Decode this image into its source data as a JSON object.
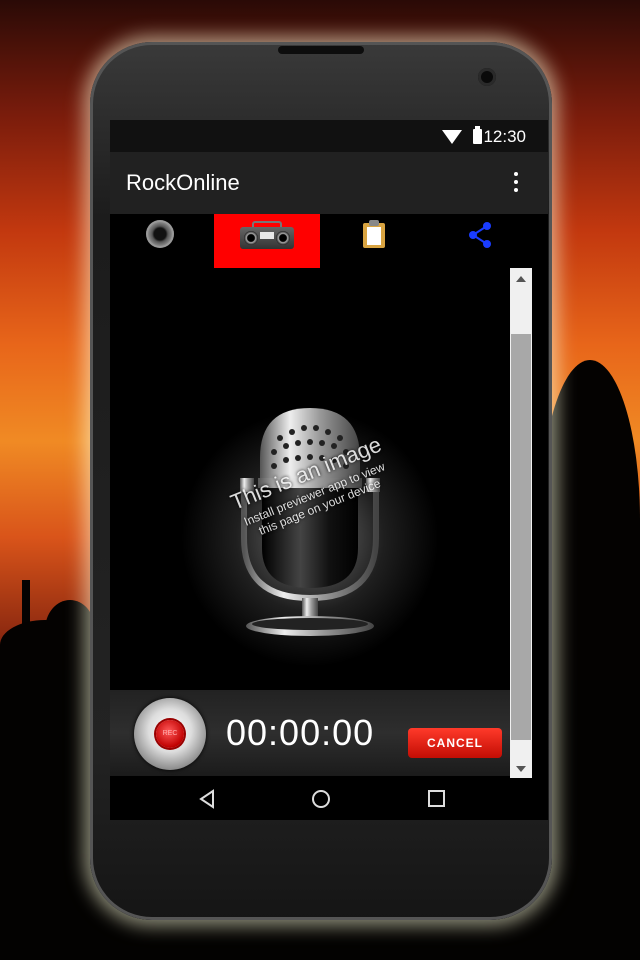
{
  "status_bar": {
    "time": "12:30"
  },
  "app_bar": {
    "title": "RockOnline"
  },
  "tabs": [
    {
      "icon": "speaker-icon",
      "active": false
    },
    {
      "icon": "radio-icon",
      "active": true
    },
    {
      "icon": "clipboard-icon",
      "active": false
    },
    {
      "icon": "share-icon",
      "active": false
    }
  ],
  "watermark": {
    "line1": "This is an image",
    "line2": "Install previewer app to view",
    "line3": "this page on your device"
  },
  "recorder": {
    "rec_label": "REC",
    "timer": "00:00:00",
    "cancel_label": "CANCEL"
  },
  "colors": {
    "active_tab": "#ff0000",
    "share_icon": "#1a3cff",
    "cancel_button": "#d8140a"
  }
}
